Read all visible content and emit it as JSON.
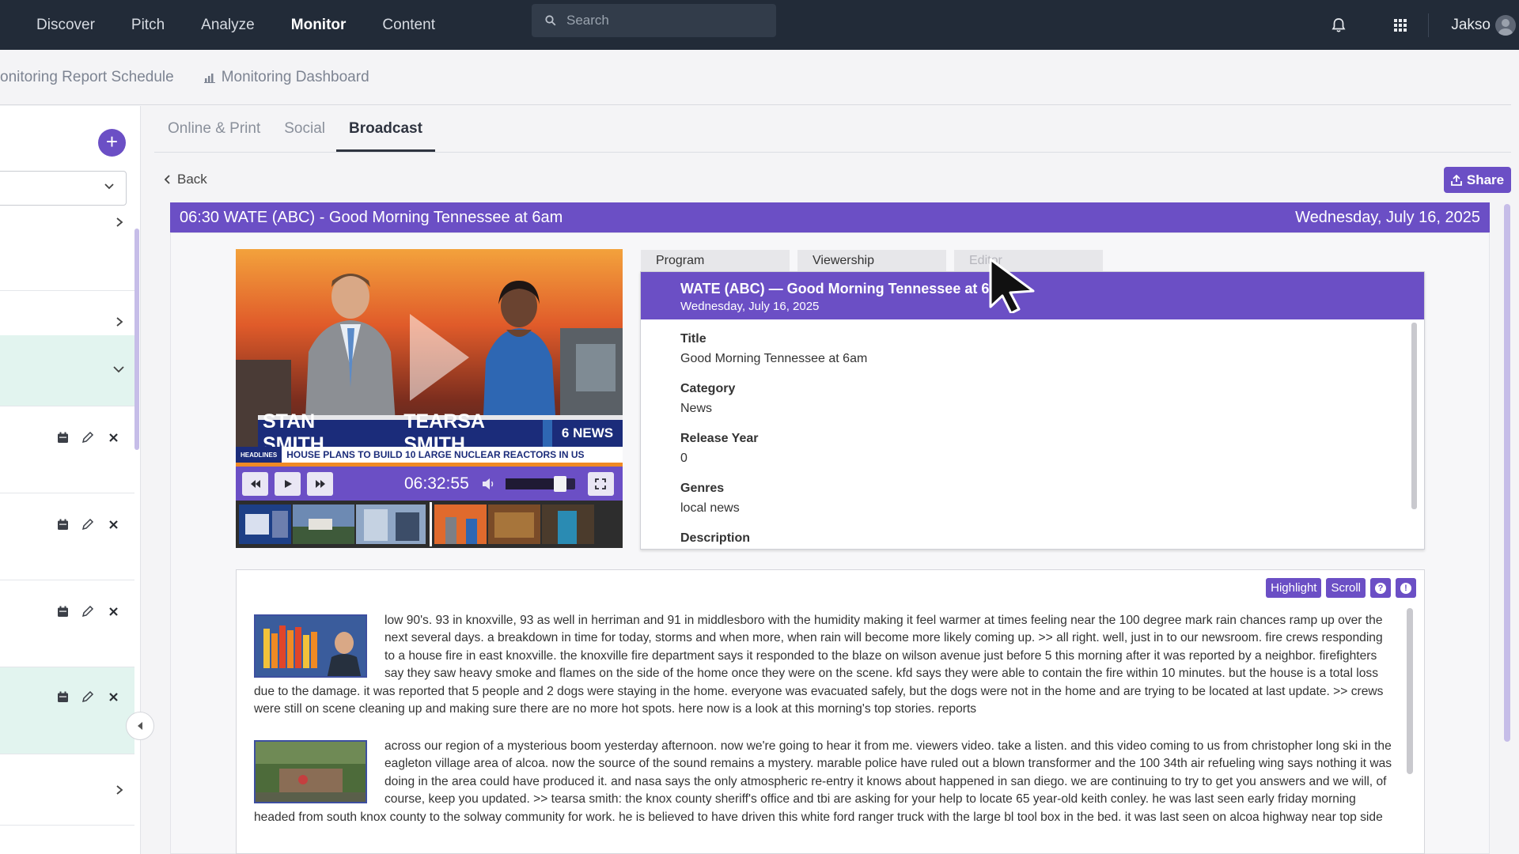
{
  "nav": {
    "items": [
      "Discover",
      "Pitch",
      "Analyze",
      "Monitor",
      "Content"
    ],
    "search_placeholder": "Search",
    "user": "Jakso"
  },
  "subheader": {
    "report_schedule": "onitoring Report Schedule",
    "dashboard": "Monitoring Dashboard"
  },
  "tabs": [
    "Online & Print",
    "Social",
    "Broadcast"
  ],
  "back_label": "Back",
  "share_label": "Share",
  "titlebar": {
    "program": "06:30 WATE (ABC) - Good Morning Tennessee at 6am",
    "date": "Wednesday, July 16, 2025"
  },
  "video": {
    "time": "06:32:55",
    "volume": 0.78,
    "anchor_names": [
      "STAN SMITH",
      "TEARSA SMITH"
    ],
    "station_logo": "6 NEWS",
    "headline_tag": "HEADLINES",
    "headline": "HOUSE PLANS TO BUILD 10 LARGE NUCLEAR REACTORS IN US"
  },
  "detail_tabs": [
    "Program",
    "Viewership",
    "Editor"
  ],
  "detail": {
    "header_title": "WATE (ABC) — Good Morning Tennessee at 6am",
    "header_date": "Wednesday, July 16, 2025",
    "fields": [
      {
        "label": "Title",
        "value": "Good Morning Tennessee at 6am"
      },
      {
        "label": "Category",
        "value": "News"
      },
      {
        "label": "Release Year",
        "value": "0"
      },
      {
        "label": "Genres",
        "value": "local news"
      },
      {
        "label": "Description",
        "value": ""
      }
    ]
  },
  "transcript": {
    "buttons": [
      "Highlight",
      "Scroll"
    ],
    "paragraphs": [
      "low 90's. 93 in knoxville, 93 as well in herriman and 91 in middlesboro with the humidity making it feel warmer at times feeling near the 100 degree mark rain chances ramp up over the next several days. a breakdown in time for today, storms and when more, when rain will become more likely coming up. >> all right. well, just in to our newsroom. fire crews responding to a house fire in east knoxville. the knoxville fire department says it responded to the blaze on wilson avenue just before 5 this morning after it was reported by a neighbor. firefighters say they saw heavy smoke and flames on the side of the home once they were on the scene. kfd says they were able to contain the fire within 10 minutes. but the house is a total loss due to the damage. it was reported that 5 people and 2 dogs were staying in the home. everyone was evacuated safely, but the dogs were not in the home and are trying to be located at last update. >> crews were still on scene cleaning up and making sure there are no more hot spots. here now is a look at this morning's top stories. reports",
      "across our region of a mysterious boom yesterday afternoon. now we're going to hear it from me. viewers video. take a listen. and this video coming to us from christopher long ski in the eagleton village area of alcoa. now the source of the sound remains a mystery. marable police have ruled out a blown transformer and the 100 34th air refueling wing says nothing it was doing in the area could have produced it. and nasa says the only atmospheric re-entry it knows about happened in san diego. we are continuing to try to get you answers and we will, of course, keep you updated. >> tearsa smith: the knox county sheriff's office and tbi are asking for your help to locate 65 year-old keith conley. he was last seen early friday morning headed from south knox county to the solway community for work. he is believed to have driven this white ford ranger truck with the large bl tool box in the bed. it was last seen on alcoa highway near top side"
    ]
  },
  "colors": {
    "nav_bg": "#222b38",
    "accent": "#6b4fc5",
    "accent_light": "#e2f4ef"
  }
}
